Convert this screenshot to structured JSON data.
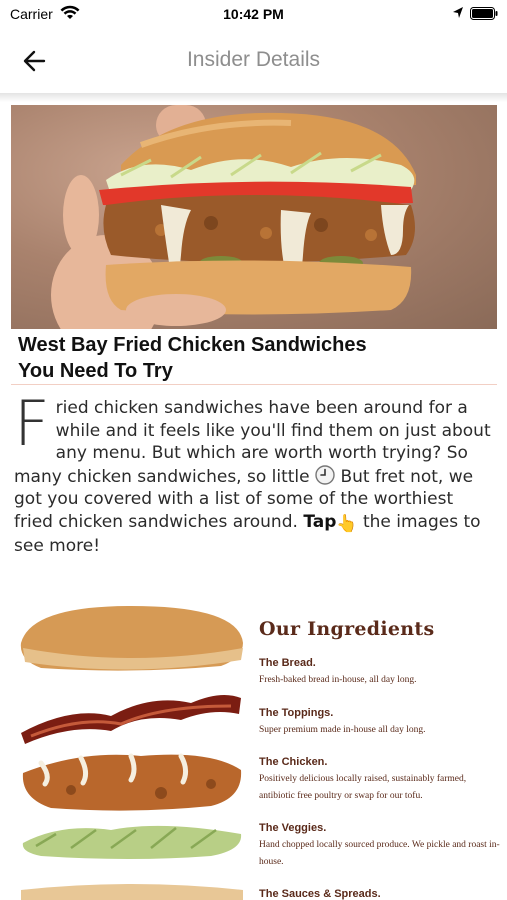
{
  "status_bar": {
    "carrier": "Carrier",
    "time": "10:42 PM",
    "icons": [
      "wifi-icon",
      "location-arrow-icon",
      "battery-icon"
    ]
  },
  "nav": {
    "title": "Insider Details",
    "back_icon": "arrow-left-icon"
  },
  "article": {
    "title_line1": "West Bay Fried Chicken Sandwiches",
    "title_line2": "You Need To Try",
    "drop_cap": "F",
    "body_part1": "ried chicken sandwiches have been around for a while and it feels like you'll find them on just about any menu. But which are worth worth trying? So many chicken sandwiches, so little",
    "body_part2": "But fret not, we got you covered with a list of some of the worthiest fried chicken sandwiches around.",
    "tap_word": "Tap",
    "hand_emoji": "👆",
    "body_part3": "the images to see more!"
  },
  "ingredients": {
    "heading": "Our Ingredients",
    "items": [
      {
        "name": "The Bread.",
        "desc": "Fresh-baked bread in-house, all day long."
      },
      {
        "name": "The Toppings.",
        "desc": "Super premium made in-house all day long."
      },
      {
        "name": "The Chicken.",
        "desc": "Positively delicious locally raised, sustainably farmed, antibiotic free poultry or swap for our tofu."
      },
      {
        "name": "The Veggies.",
        "desc": "Hand chopped locally sourced produce. We pickle and roast in-house."
      },
      {
        "name": "The Sauces & Spreads.",
        "desc": ""
      }
    ]
  },
  "colors": {
    "nav_title": "#8e8e8e",
    "ingredient_brown": "#5a2a1a",
    "divider": "#f2cfc4"
  }
}
